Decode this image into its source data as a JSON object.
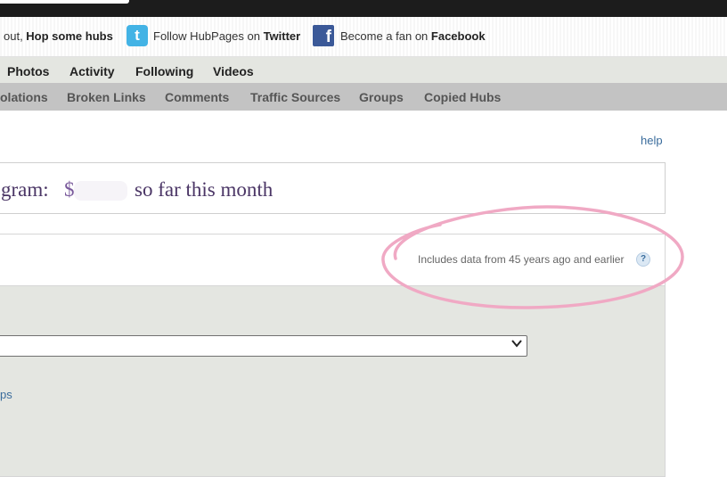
{
  "social": {
    "hop_prefix": "out, ",
    "hop_bold": "Hop some hubs",
    "twitter_prefix": "Follow HubPages on ",
    "twitter_bold": "Twitter",
    "facebook_prefix": "Become a fan on ",
    "facebook_bold": "Facebook",
    "twitter_icon": "t",
    "facebook_icon": "f"
  },
  "nav_primary": [
    "Photos",
    "Activity",
    "Following",
    "Videos"
  ],
  "nav_secondary": [
    "olations",
    "Broken Links",
    "Comments",
    "Traffic Sources",
    "Groups",
    "Copied Hubs"
  ],
  "help_link": "help",
  "earnings": {
    "prefix": "gram:",
    "currency": "$",
    "suffix": "so far this month"
  },
  "data_note": "Includes data from 45 years ago and earlier",
  "info_icon": "?",
  "dropdown": {
    "chevron": "⌄"
  },
  "partial_link": "ps",
  "colors": {
    "topbar": "#1c1c1c",
    "nav_primary_bg": "#e4e6e1",
    "nav_secondary_bg": "#c3c3c3",
    "link": "#3a6c9c",
    "earnings_text": "#4a3565",
    "annotation": "#f0a9c4",
    "twitter": "#43b3e5",
    "facebook": "#3b5998"
  }
}
